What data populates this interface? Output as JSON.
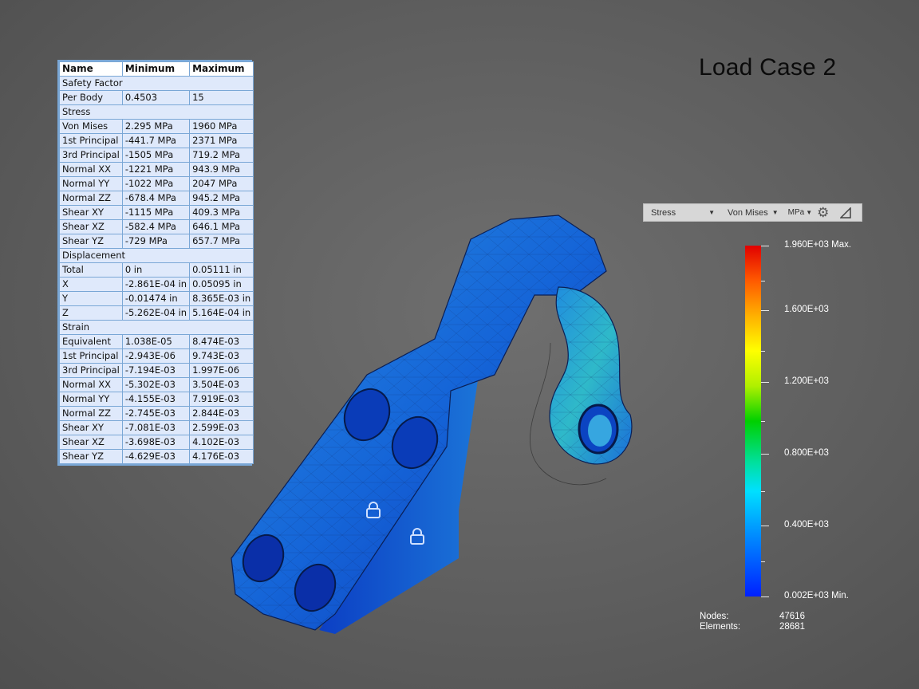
{
  "title": "Load Case 2",
  "table": {
    "headers": [
      "Name",
      "Minimum",
      "Maximum"
    ],
    "rows": [
      {
        "section": "Safety Factor"
      },
      {
        "name": "Per Body",
        "min": "0.4503",
        "max": "15"
      },
      {
        "section": "Stress"
      },
      {
        "name": "Von Mises",
        "min": "2.295 MPa",
        "max": "1960 MPa"
      },
      {
        "name": "1st Principal",
        "min": "-441.7 MPa",
        "max": "2371 MPa"
      },
      {
        "name": "3rd Principal",
        "min": "-1505 MPa",
        "max": "719.2 MPa"
      },
      {
        "name": "Normal XX",
        "min": "-1221 MPa",
        "max": "943.9 MPa"
      },
      {
        "name": "Normal YY",
        "min": "-1022 MPa",
        "max": "2047 MPa"
      },
      {
        "name": "Normal ZZ",
        "min": "-678.4 MPa",
        "max": "945.2 MPa"
      },
      {
        "name": "Shear XY",
        "min": "-1115 MPa",
        "max": "409.3 MPa"
      },
      {
        "name": "Shear XZ",
        "min": "-582.4 MPa",
        "max": "646.1 MPa"
      },
      {
        "name": "Shear YZ",
        "min": "-729 MPa",
        "max": "657.7 MPa"
      },
      {
        "section": "Displacement"
      },
      {
        "name": "Total",
        "min": "0 in",
        "max": "0.05111 in"
      },
      {
        "name": "X",
        "min": "-2.861E-04 in",
        "max": "0.05095 in"
      },
      {
        "name": "Y",
        "min": "-0.01474 in",
        "max": "8.365E-03 in"
      },
      {
        "name": "Z",
        "min": "-5.262E-04 in",
        "max": "5.164E-04 in"
      },
      {
        "section": "Strain"
      },
      {
        "name": "Equivalent",
        "min": "1.038E-05",
        "max": "8.474E-03"
      },
      {
        "name": "1st Principal",
        "min": "-2.943E-06",
        "max": "9.743E-03"
      },
      {
        "name": "3rd Principal",
        "min": "-7.194E-03",
        "max": "1.997E-06"
      },
      {
        "name": "Normal XX",
        "min": "-5.302E-03",
        "max": "3.504E-03"
      },
      {
        "name": "Normal YY",
        "min": "-4.155E-03",
        "max": "7.919E-03"
      },
      {
        "name": "Normal ZZ",
        "min": "-2.745E-03",
        "max": "2.844E-03"
      },
      {
        "name": "Shear XY",
        "min": "-7.081E-03",
        "max": "2.599E-03"
      },
      {
        "name": "Shear XZ",
        "min": "-3.698E-03",
        "max": "4.102E-03"
      },
      {
        "name": "Shear YZ",
        "min": "-4.629E-03",
        "max": "4.176E-03"
      }
    ]
  },
  "toolbar": {
    "result_type": "Stress",
    "component": "Von Mises",
    "unit": "MPa",
    "icons": [
      "gear-icon",
      "triangle-ruler-icon"
    ]
  },
  "legend": {
    "labels": [
      {
        "text": "1.960E+03 Max.",
        "value": 1960
      },
      {
        "text": "1.600E+03",
        "value": 1600
      },
      {
        "text": "1.200E+03",
        "value": 1200
      },
      {
        "text": "0.800E+03",
        "value": 800
      },
      {
        "text": "0.400E+03",
        "value": 400
      },
      {
        "text": "0.002E+03 Min.",
        "value": 2
      }
    ],
    "colors": [
      "#e10000",
      "#ffff00",
      "#00d000",
      "#00e0ff",
      "#0020ff"
    ]
  },
  "stats": {
    "nodes_label": "Nodes:",
    "nodes_value": "47616",
    "elements_label": "Elements:",
    "elements_value": "28681"
  }
}
